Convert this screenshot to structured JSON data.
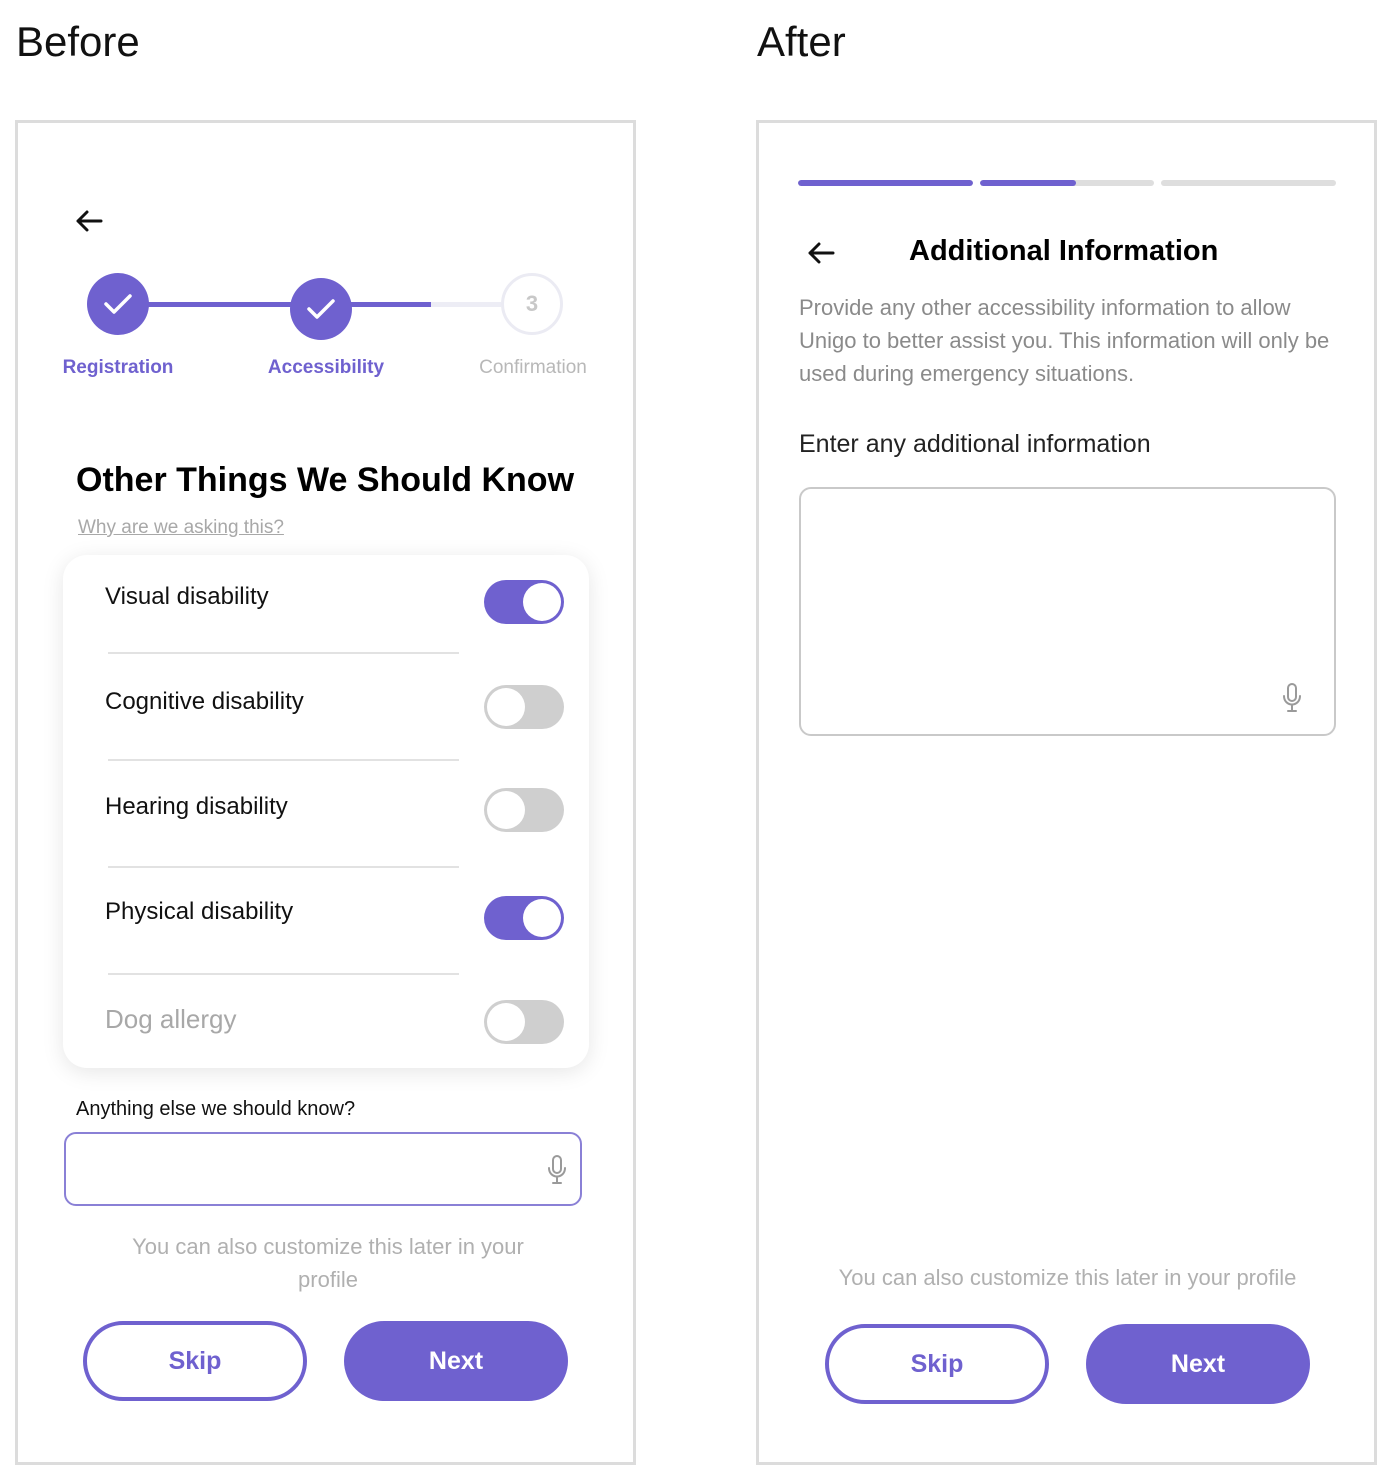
{
  "before": {
    "heading": "Before",
    "stepper": {
      "steps": [
        {
          "label": "Registration",
          "state": "complete",
          "icon": "check-icon"
        },
        {
          "label": "Accessibility",
          "state": "complete",
          "icon": "check-icon"
        },
        {
          "label": "Confirmation",
          "state": "upcoming",
          "number": "3"
        }
      ]
    },
    "title": "Other Things We Should Know",
    "why_link": "Why are we asking this?",
    "toggles": [
      {
        "label": "Visual disability",
        "on": true
      },
      {
        "label": "Cognitive disability",
        "on": false
      },
      {
        "label": "Hearing disability",
        "on": false
      },
      {
        "label": "Physical disability",
        "on": true
      },
      {
        "label": "Dog allergy",
        "on": false
      }
    ],
    "else_label": "Anything else we should know?",
    "input_value": "",
    "hint": "You can also customize this later in your profile",
    "skip_label": "Skip",
    "next_label": "Next"
  },
  "after": {
    "heading": "After",
    "progress": [
      1.0,
      0.55,
      0.0
    ],
    "title": "Additional Information",
    "description": "Provide any other accessibility information to allow Unigo to better assist you. This information will only be used during emergency situations.",
    "field_label": "Enter any additional information",
    "textarea_value": "",
    "hint": "You can also customize this later in your profile",
    "skip_label": "Skip",
    "next_label": "Next"
  },
  "colors": {
    "accent": "#6f61cf",
    "toggle_off": "#cfcfcf",
    "muted_text": "#b0b0b0",
    "frame_border": "#dcdcdc"
  },
  "icons": [
    "back-arrow-icon",
    "check-icon",
    "microphone-icon"
  ]
}
